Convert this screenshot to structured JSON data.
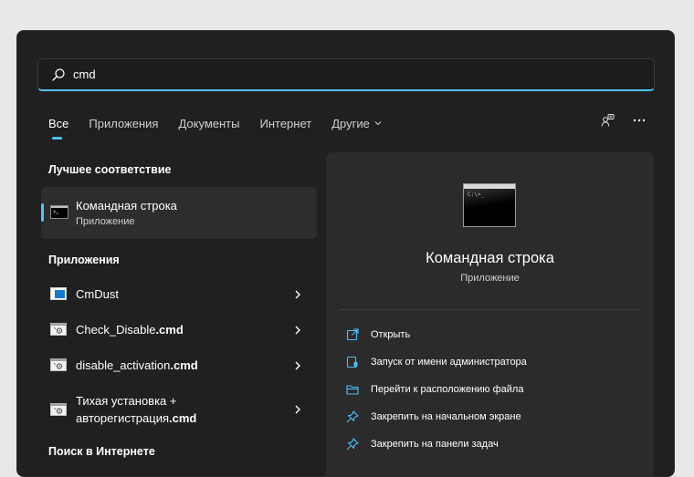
{
  "search": {
    "value": "cmd",
    "placeholder": ""
  },
  "tabs": [
    {
      "label": "Все",
      "active": true
    },
    {
      "label": "Приложения",
      "active": false
    },
    {
      "label": "Документы",
      "active": false
    },
    {
      "label": "Интернет",
      "active": false
    },
    {
      "label": "Другие",
      "active": false,
      "dropdown": true
    }
  ],
  "toolbar": {
    "account_icon": "people-icon",
    "more_icon": "more-icon"
  },
  "sections": {
    "best_match": "Лучшее соответствие",
    "apps": "Приложения",
    "web": "Поиск в Интернете"
  },
  "best_match": {
    "title": "Командная строка",
    "subtitle": "Приложение"
  },
  "apps": [
    {
      "name": "CmDust",
      "icon": "app-window-icon"
    },
    {
      "name": "Check_Disable",
      "ext": ".cmd",
      "icon": "script-file-icon"
    },
    {
      "name": "disable_activation",
      "ext": ".cmd",
      "icon": "script-file-icon"
    },
    {
      "name": "Тихая установка +",
      "line2": "авторегистрация",
      "ext": ".cmd",
      "icon": "script-file-icon"
    }
  ],
  "preview": {
    "title": "Командная строка",
    "subtitle": "Приложение",
    "icon_prompt": "C:\\>_",
    "actions": [
      {
        "label": "Открыть",
        "icon": "open-external-icon"
      },
      {
        "label": "Запуск от имени администратора",
        "icon": "admin-shield-icon"
      },
      {
        "label": "Перейти к расположению файла",
        "icon": "folder-icon"
      },
      {
        "label": "Закрепить на начальном экране",
        "icon": "pin-icon"
      },
      {
        "label": "Закрепить на панели задач",
        "icon": "pin-icon"
      }
    ]
  },
  "colors": {
    "accent": "#4cc2ff",
    "background": "#202020",
    "panel": "#2b2b2b"
  }
}
